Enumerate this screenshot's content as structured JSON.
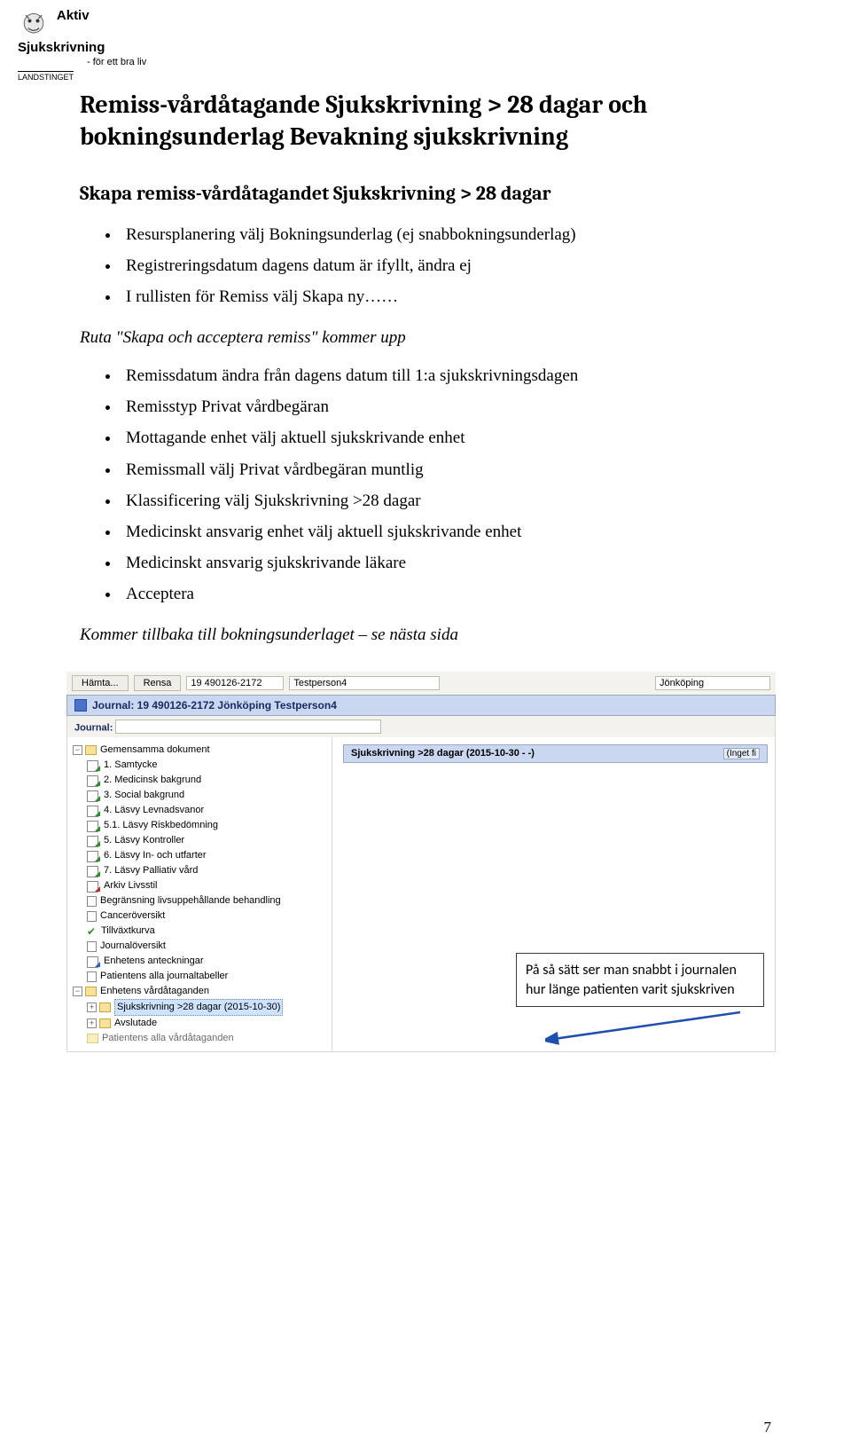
{
  "logo": {
    "brand_main": "Aktiv Sjukskrivning",
    "brand_sub": "- för ett bra liv",
    "brand_bot": "LANDSTINGET"
  },
  "heading": "Remiss-vårdåtagande Sjukskrivning > 28 dagar och bokningsunderlag Bevakning sjukskrivning",
  "subheading": "Skapa remiss-vårdåtagandet Sjukskrivning > 28 dagar",
  "bullets1": [
    "Resursplanering välj Bokningsunderlag (ej snabbokningsunderlag)",
    "Registreringsdatum dagens datum är ifyllt, ändra ej",
    "I rullisten för Remiss välj Skapa ny……"
  ],
  "italic1": "Ruta \"Skapa och acceptera remiss\" kommer upp",
  "bullets2": [
    "Remissdatum ändra från dagens datum till 1:a sjukskrivningsdagen",
    "Remisstyp Privat vårdbegäran",
    "Mottagande enhet välj aktuell sjukskrivande enhet",
    "Remissmall välj Privat vårdbegäran muntlig",
    "Klassificering välj Sjukskrivning >28 dagar",
    "Medicinskt ansvarig enhet välj aktuell sjukskrivande enhet",
    "Medicinskt ansvarig sjukskrivande läkare",
    "Acceptera"
  ],
  "italic2": "Kommer tillbaka till bokningsunderlaget – se nästa sida",
  "app": {
    "toolbar": {
      "fetch": "Hämta...",
      "clear": "Rensa",
      "pid": "19 490126-2172",
      "name": "Testperson4",
      "right": "Jönköping"
    },
    "journal_bar": "Journal: 19 490126-2172 Jönköping Testperson4",
    "journal_label": "Journal:",
    "pane_header": "Sjukskrivning >28 dagar (2015-10-30 - -)",
    "pane_dropdown": "(Inget fi",
    "tree": {
      "root": "Gemensamma dokument",
      "children": [
        "1. Samtycke",
        "2. Medicinsk bakgrund",
        "3. Social bakgrund",
        "4. Läsvy Levnadsvanor",
        "5.1. Läsvy Riskbedömning",
        "5. Läsvy Kontroller",
        "6. Läsvy In- och utfarter",
        "7. Läsvy Palliativ vård",
        "Arkiv Livsstil",
        "Begränsning livsuppehållande behandling",
        "Canceröversikt",
        "Tillväxtkurva",
        "Journalöversikt",
        "Enhetens anteckningar",
        "Patientens alla journaltabeller",
        "Enhetens vårdåtaganden"
      ],
      "sub": [
        "Sjukskrivning >28 dagar (2015-10-30)",
        "Avslutade",
        "Patientens alla vårdåtaganden"
      ]
    },
    "annotation": "På så sätt ser man snabbt i journalen hur länge patienten varit sjukskriven"
  },
  "page_number": "7"
}
